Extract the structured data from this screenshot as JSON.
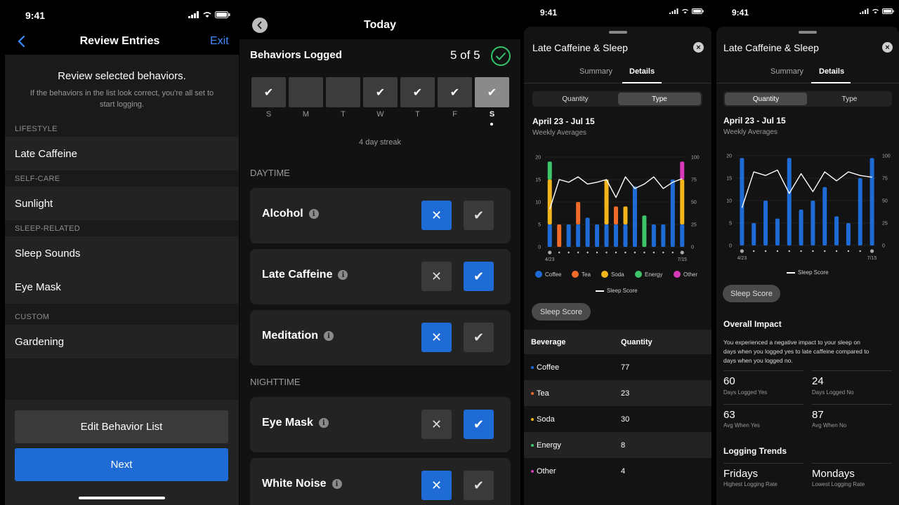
{
  "status": {
    "time": "9:41"
  },
  "review": {
    "back_icon": "chevron-left-icon",
    "title": "Review Entries",
    "exit": "Exit",
    "heading": "Review selected behaviors.",
    "subtext_line1": "If the behaviors in the list look correct, you're all set to",
    "subtext_line2": "start logging.",
    "sections": [
      {
        "header": "LIFESTYLE",
        "items": [
          "Late Caffeine"
        ]
      },
      {
        "header": "SELF-CARE",
        "items": [
          "Sunlight"
        ]
      },
      {
        "header": "SLEEP-RELATED",
        "items": [
          "Sleep Sounds",
          "Eye Mask"
        ]
      },
      {
        "header": "CUSTOM",
        "items": [
          "Gardening"
        ]
      }
    ],
    "edit_button": "Edit Behavior List",
    "next_button": "Next"
  },
  "today": {
    "title": "Today",
    "logged_title": "Behaviors Logged",
    "logged_count": "5 of 5",
    "days": [
      {
        "letter": "S",
        "checked": true
      },
      {
        "letter": "M",
        "checked": false
      },
      {
        "letter": "T",
        "checked": false
      },
      {
        "letter": "W",
        "checked": true
      },
      {
        "letter": "T",
        "checked": true
      },
      {
        "letter": "F",
        "checked": true
      },
      {
        "letter": "S",
        "checked": true,
        "current": true
      }
    ],
    "streak": "4 day streak",
    "daytime_header": "DAYTIME",
    "nighttime_header": "NIGHTTIME",
    "daytime": [
      {
        "label": "Alcohol",
        "answer": "no"
      },
      {
        "label": "Late Caffeine",
        "answer": "yes"
      },
      {
        "label": "Meditation",
        "answer": "no"
      }
    ],
    "nighttime": [
      {
        "label": "Eye Mask",
        "answer": "yes"
      },
      {
        "label": "White Noise",
        "answer": "no"
      }
    ]
  },
  "detail_type": {
    "time": "9:41",
    "title": "Late Caffeine & Sleep",
    "tab_summary": "Summary",
    "tab_details": "Details",
    "seg_quantity": "Quantity",
    "seg_type": "Type",
    "range": "April 23 - Jul 15",
    "subrange": "Weekly Averages",
    "x_start": "4/23",
    "x_end": "7/15",
    "legend": [
      "Coffee",
      "Tea",
      "Soda",
      "Energy",
      "Other"
    ],
    "line_legend": "Sleep Score",
    "pill": "Sleep Score",
    "table_header": {
      "col1": "Beverage",
      "col2": "Quantity"
    },
    "table_rows": [
      {
        "name": "Coffee",
        "qty": "77",
        "color": "#1f6bd6"
      },
      {
        "name": "Tea",
        "qty": "23",
        "color": "#f06a2a"
      },
      {
        "name": "Soda",
        "qty": "30",
        "color": "#f2b51c"
      },
      {
        "name": "Energy",
        "qty": "8",
        "color": "#3ec56a"
      },
      {
        "name": "Other",
        "qty": "4",
        "color": "#d63ab8"
      }
    ]
  },
  "detail_quantity": {
    "time": "9:41",
    "title": "Late Caffeine & Sleep",
    "tab_summary": "Summary",
    "tab_details": "Details",
    "seg_quantity": "Quantity",
    "seg_type": "Type",
    "range": "April 23 - Jul 15",
    "subrange": "Weekly Averages",
    "x_start": "4/23",
    "x_end": "7/15",
    "line_legend": "Sleep Score",
    "pill": "Sleep Score",
    "impact_title": "Overall Impact",
    "impact_line1": "You experienced a negative impact to your sleep on",
    "impact_line2": "days when you logged yes to late caffeine compared to",
    "impact_line3": "days when you logged no.",
    "stats": [
      {
        "num": "60",
        "label": "Days Logged Yes"
      },
      {
        "num": "24",
        "label": "Days Logged No"
      },
      {
        "num": "63",
        "label": "Avg When Yes"
      },
      {
        "num": "87",
        "label": "Avg When No"
      }
    ],
    "trends_title": "Logging Trends",
    "trends": [
      {
        "num": "Fridays",
        "label": "Highest Logging Rate"
      },
      {
        "num": "Mondays",
        "label": "Lowest Logging Rate"
      }
    ]
  },
  "chart_data": [
    {
      "type": "bar",
      "stacked": true,
      "ylim_left": [
        0,
        20
      ],
      "ylim_right": [
        0,
        100
      ],
      "yticks_left": [
        "0",
        "5",
        "10",
        "15",
        "20"
      ],
      "yticks_right": [
        "0",
        "25",
        "50",
        "75",
        "100"
      ],
      "series": [
        {
          "name": "Coffee",
          "color": "#1f6bd6",
          "values": [
            5,
            0,
            5,
            5,
            6.5,
            5,
            5,
            5,
            5,
            13.5,
            0,
            5,
            5,
            15,
            5
          ]
        },
        {
          "name": "Tea",
          "color": "#f06a2a",
          "values": [
            0,
            5,
            0,
            5,
            0,
            0,
            0,
            4,
            0,
            0,
            0,
            0,
            0,
            0,
            0
          ]
        },
        {
          "name": "Soda",
          "color": "#f2b51c",
          "values": [
            10,
            0,
            0,
            0,
            0,
            0,
            10,
            0,
            4,
            0,
            0,
            0,
            0,
            0,
            10
          ]
        },
        {
          "name": "Energy",
          "color": "#3ec56a",
          "values": [
            4,
            0,
            0,
            0,
            0,
            0,
            0,
            0,
            0,
            0,
            7,
            0,
            0,
            0,
            0
          ]
        },
        {
          "name": "Other",
          "color": "#d63ab8",
          "values": [
            0,
            0,
            0,
            0,
            0,
            0,
            0,
            0,
            0,
            0,
            0,
            0,
            0,
            0,
            4
          ]
        }
      ],
      "line": {
        "name": "Sleep Score",
        "values": [
          42,
          75,
          72,
          78,
          70,
          72,
          75,
          55,
          78,
          65,
          70,
          78,
          65,
          72,
          76
        ]
      }
    },
    {
      "type": "bar",
      "ylim_left": [
        0,
        20
      ],
      "ylim_right": [
        0,
        100
      ],
      "yticks_left": [
        "0",
        "5",
        "10",
        "15",
        "20"
      ],
      "yticks_right": [
        "0",
        "25",
        "50",
        "75",
        "100"
      ],
      "series": [
        {
          "name": "Quantity",
          "color": "#1f6bd6",
          "values": [
            19.5,
            5,
            10,
            6,
            19.5,
            8,
            10,
            13,
            6.5,
            5,
            15,
            19.5
          ]
        }
      ],
      "line": {
        "name": "Sleep Score",
        "values": [
          42,
          82,
          78,
          84,
          58,
          80,
          60,
          82,
          72,
          82,
          78,
          76
        ]
      }
    }
  ]
}
